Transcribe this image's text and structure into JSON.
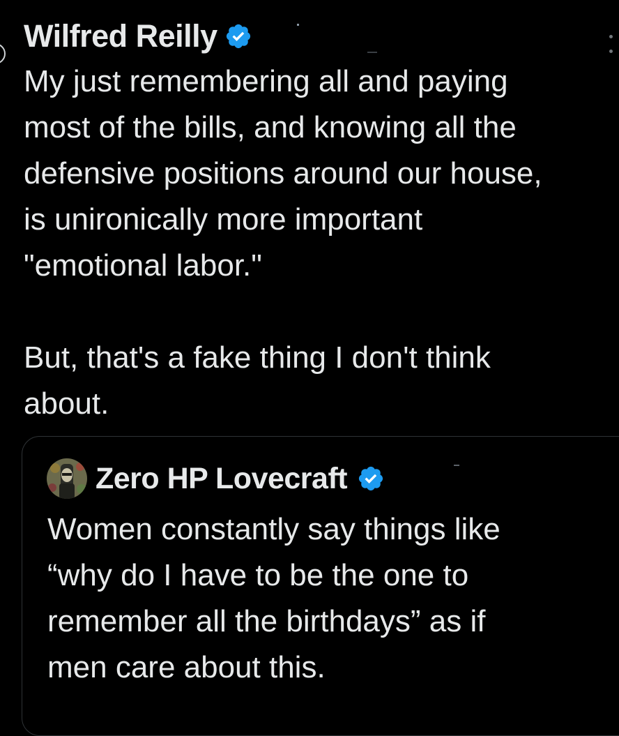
{
  "tweet": {
    "author_name": "Wilfred Reilly",
    "verified_icon": "verified-badge-icon",
    "more_icon": "more-options-icon",
    "text": "My just remembering all and paying\nmost of the bills, and knowing all the\ndefensive positions around our house,\nis unironically more important\n\"emotional labor.\"\n\nBut, that's a fake thing I don't think\nabout."
  },
  "quote": {
    "author_name": "Zero HP Lovecraft",
    "verified_icon": "verified-badge-icon",
    "text": "Women constantly say things like\n“why do I have to be the one to\nremember all the birthdays” as if\nmen care about this."
  },
  "colors": {
    "background": "#000000",
    "text": "#e7e9ea",
    "verified_blue": "#1d9bf0",
    "border": "#2f3336",
    "muted": "#71767b"
  }
}
